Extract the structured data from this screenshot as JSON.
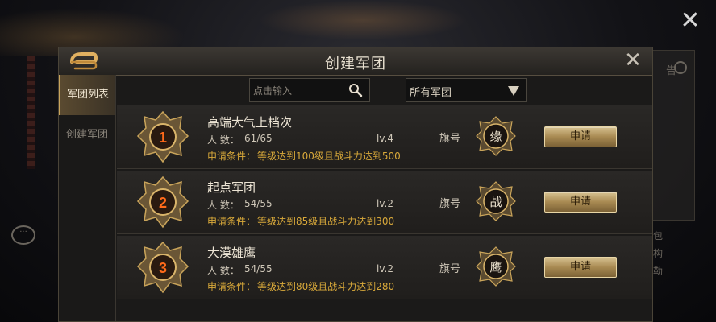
{
  "dialog": {
    "title": "创建军团"
  },
  "tabs": [
    {
      "label": "军团列表",
      "active": true
    },
    {
      "label": "创建军团",
      "active": false
    }
  ],
  "search": {
    "placeholder": "点击输入"
  },
  "filter": {
    "selected": "所有军团"
  },
  "background": {
    "right_panel_text": "告",
    "side_chars": [
      "包",
      "构",
      "勒"
    ]
  },
  "labels": {
    "members": "人 数：",
    "requirement": "申请条件：",
    "flag": "旗号",
    "apply": "申请"
  },
  "guilds": [
    {
      "rank": "1",
      "name": "高端大气上档次",
      "members": "61/65",
      "level": "lv.4",
      "requirement": "等级达到100级且战斗力达到500",
      "flag": "缘"
    },
    {
      "rank": "2",
      "name": "起点军团",
      "members": "54/55",
      "level": "lv.2",
      "requirement": "等级达到85级且战斗力达到300",
      "flag": "战"
    },
    {
      "rank": "3",
      "name": "大漠雄鹰",
      "members": "54/55",
      "level": "lv.2",
      "requirement": "等级达到80级且战斗力达到280",
      "flag": "鹰"
    }
  ],
  "colors": {
    "gold_text": "#d9a93a",
    "rank_number": "#ff6a1a",
    "button_gold": "#b99a60"
  }
}
